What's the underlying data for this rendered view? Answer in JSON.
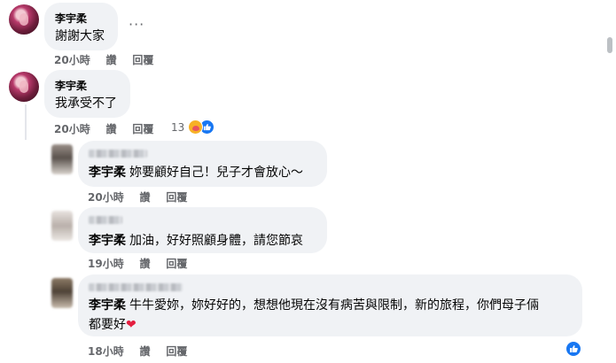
{
  "comments": [
    {
      "author": "李宇柔",
      "text": "謝謝大家",
      "time": "20小時",
      "like_label": "讚",
      "reply_label": "回覆",
      "more_label": "···"
    },
    {
      "author": "李宇柔",
      "text": "我承受不了",
      "time": "20小時",
      "like_label": "讚",
      "reply_label": "回覆",
      "reaction_count": "13"
    }
  ],
  "replies": [
    {
      "mention": "李宇柔",
      "text": "妳要顧好自己！兒子才會放心～",
      "time": "20小時",
      "like_label": "讚",
      "reply_label": "回覆"
    },
    {
      "mention": "李宇柔",
      "text": "加油，好好照顧身體，請您節哀",
      "time": "19小時",
      "like_label": "讚",
      "reply_label": "回覆"
    },
    {
      "mention": "李宇柔",
      "text_line1": "牛牛愛妳，妳好好的，想想他現在沒有病苦與限制，新的旅程，你們母子倆",
      "text_line2": "都要好",
      "emoji": "❤",
      "time": "18小時",
      "like_label": "讚",
      "reply_label": "回覆"
    }
  ],
  "colors": {
    "bubble": "#f0f2f5",
    "meta": "#65676b",
    "like_blue": "#1877f2",
    "heart": "#e41e3f"
  },
  "icons": {
    "care_reaction": "care-reaction-icon",
    "like_reaction": "like-reaction-icon",
    "heart": "heart-emoji"
  }
}
